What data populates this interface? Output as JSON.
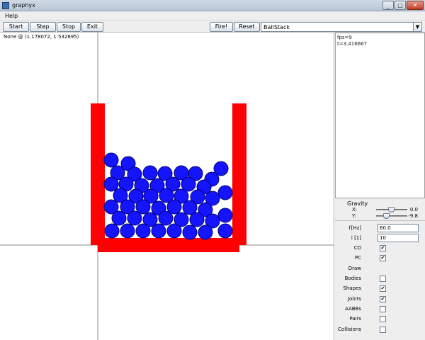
{
  "window": {
    "title": "graphyx"
  },
  "menu": {
    "items": [
      "Help"
    ]
  },
  "toolbar": {
    "start_label": "Start",
    "step_label": "Step",
    "stop_label": "Stop",
    "exit_label": "Exit",
    "fire_label": "Fire!",
    "reset_label": "Reset",
    "scene_selected": "BallStack"
  },
  "canvas": {
    "coordinate_readout": "None @ (1.178072, 1.532695)"
  },
  "stats": {
    "fps": "fps=9",
    "time": "t=3.416667"
  },
  "gravity": {
    "title": "Gravity",
    "x_label": "X:",
    "x_value": "0.0",
    "y_label": "Y:",
    "y_value": "-9.8"
  },
  "params": {
    "frequency_label": "f [Hz]",
    "frequency_value": "60.0",
    "iterations_label": "i [1]",
    "iterations_value": "10",
    "cd_label": "CD",
    "cd_checked": true,
    "pc_label": "PC",
    "pc_checked": true,
    "draw_label": "Draw",
    "bodies_label": "Bodies",
    "bodies_checked": false,
    "shapes_label": "Shapes",
    "shapes_checked": true,
    "joints_label": "Joints",
    "joints_checked": true,
    "aabbs_label": "AABBs",
    "aabbs_checked": false,
    "pairs_label": "Pairs",
    "pairs_checked": false,
    "collisions_label": "Collisions",
    "collisions_checked": false
  },
  "colors": {
    "container": "#ff0000",
    "ball_fill": "#1414ff",
    "ball_stroke": "#00006e",
    "axis": "#888888"
  },
  "icons": {
    "app": "app-icon",
    "minimize": "minimize-icon",
    "maximize": "maximize-icon",
    "close": "close-icon",
    "dropdown": "chevron-down-icon",
    "check": "checkmark-icon"
  }
}
